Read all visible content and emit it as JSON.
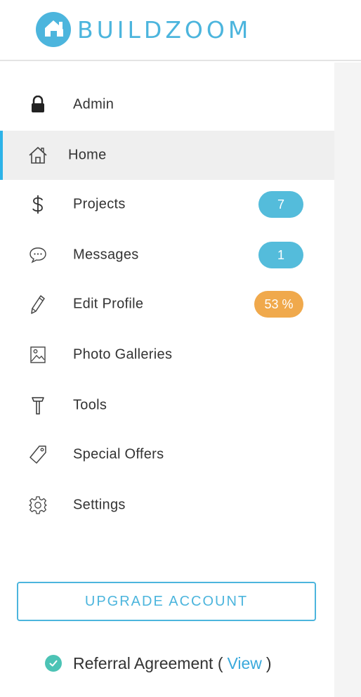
{
  "brand": {
    "name": "BUILDZOOM",
    "color": "#4cb5dd"
  },
  "nav": {
    "items": [
      {
        "label": "Admin",
        "icon": "lock-icon"
      },
      {
        "label": "Home",
        "icon": "home-icon",
        "active": true
      },
      {
        "label": "Projects",
        "icon": "dollar-icon",
        "badge": "7"
      },
      {
        "label": "Messages",
        "icon": "chat-bubble-icon",
        "badge": "1"
      },
      {
        "label": "Edit Profile",
        "icon": "pencil-icon",
        "badge": "53 %"
      },
      {
        "label": "Photo Galleries",
        "icon": "image-icon"
      },
      {
        "label": "Tools",
        "icon": "hammer-icon"
      },
      {
        "label": "Special Offers",
        "icon": "tag-icon"
      },
      {
        "label": "Settings",
        "icon": "gear-icon"
      }
    ]
  },
  "upgrade": {
    "label": "UPGRADE ACCOUNT"
  },
  "referral": {
    "text": "Referral Agreement (",
    "link": "View",
    "close": ")"
  },
  "colors": {
    "accent": "#4cb5dd",
    "badge_blue": "#54bcdb",
    "badge_orange": "#f0a94c",
    "active_bg": "#efefef",
    "active_bar": "#2db3e8",
    "check": "#4cc3b5"
  }
}
